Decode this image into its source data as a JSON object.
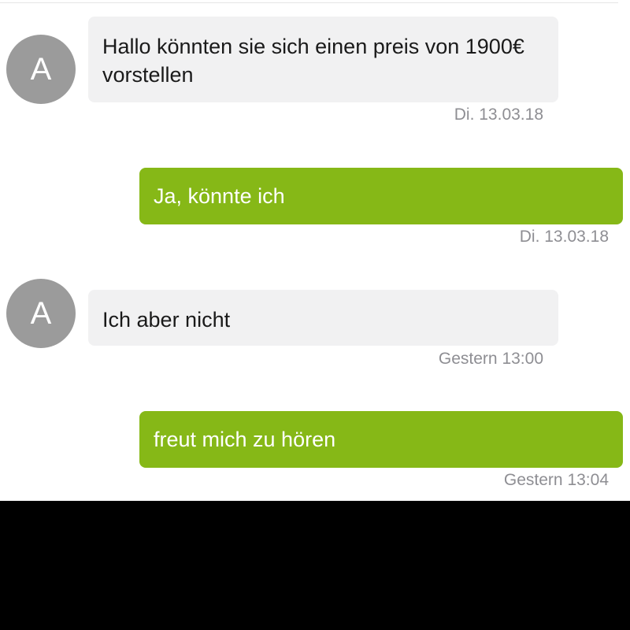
{
  "messages": [
    {
      "direction": "incoming",
      "avatar_letter": "A",
      "text": "Hallo könnten sie sich einen preis von 1900€ vorstellen",
      "timestamp": "Di. 13.03.18"
    },
    {
      "direction": "outgoing",
      "text": "Ja, könnte ich",
      "timestamp": "Di. 13.03.18"
    },
    {
      "direction": "incoming",
      "avatar_letter": "A",
      "text": "Ich aber nicht",
      "timestamp": "Gestern 13:00"
    },
    {
      "direction": "outgoing",
      "text": "freut mich zu hören",
      "timestamp": "Gestern 13:04"
    }
  ],
  "colors": {
    "incoming_bubble": "#f1f1f2",
    "outgoing_bubble": "#86b817",
    "avatar": "#9b9b9b",
    "timestamp": "#8e8e93"
  }
}
